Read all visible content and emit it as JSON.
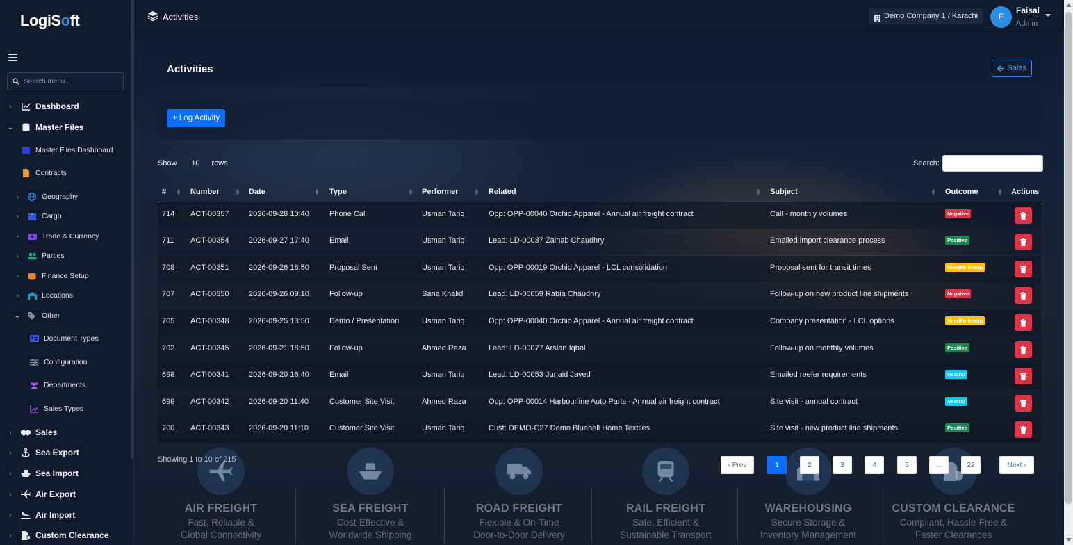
{
  "app": {
    "logo_part1": "LogiS",
    "logo_o": "o",
    "logo_part2": "ft"
  },
  "sidebar": {
    "search_placeholder": "Search menu...",
    "items": [
      {
        "label": "Dashboard"
      },
      {
        "label": "Master Files"
      },
      {
        "label": "Master Files Dashboard"
      },
      {
        "label": "Contracts"
      },
      {
        "label": "Geography"
      },
      {
        "label": "Cargo"
      },
      {
        "label": "Trade & Currency"
      },
      {
        "label": "Parties"
      },
      {
        "label": "Finance Setup"
      },
      {
        "label": "Locations"
      },
      {
        "label": "Other"
      },
      {
        "label": "Document Types"
      },
      {
        "label": "Configuration"
      },
      {
        "label": "Departments"
      },
      {
        "label": "Sales Types"
      },
      {
        "label": "Sales"
      },
      {
        "label": "Sea Export"
      },
      {
        "label": "Sea Import"
      },
      {
        "label": "Air Export"
      },
      {
        "label": "Air Import"
      },
      {
        "label": "Custom Clearance"
      }
    ]
  },
  "topbar": {
    "title": "Activities",
    "company": "Demo Company 1 / Karachi",
    "user_initial": "F",
    "user_name": "Faisal",
    "user_role": "Admin"
  },
  "page": {
    "title": "Activities",
    "back_label": "Sales",
    "log_button": "+ Log Activity",
    "show_label": "Show",
    "rows_value": "10",
    "rows_label": "rows",
    "search_label": "Search:"
  },
  "table": {
    "columns": [
      "#",
      "Number",
      "Date",
      "Type",
      "Performer",
      "Related",
      "Subject",
      "Outcome",
      "Actions"
    ],
    "rows": [
      {
        "id": "714",
        "number": "ACT-00357",
        "date": "2026-09-28 10:40",
        "type": "Phone Call",
        "performer": "Usman Tariq",
        "related": "Opp: OPP-00040 Orchid Apparel - Annual air freight contract",
        "subject": "Call - monthly volumes",
        "outcome": "Negative"
      },
      {
        "id": "711",
        "number": "ACT-00354",
        "date": "2026-09-27 17:40",
        "type": "Email",
        "performer": "Usman Tariq",
        "related": "Lead: LD-00037 Zainab Chaudhry",
        "subject": "Emailed import clearance process",
        "outcome": "Positive"
      },
      {
        "id": "708",
        "number": "ACT-00351",
        "date": "2026-09-26 18:50",
        "type": "Proposal Sent",
        "performer": "Usman Tariq",
        "related": "Opp: OPP-00019 Orchid Apparel - LCL consolidation",
        "subject": "Proposal sent for transit times",
        "outcome": "NeedFollowup"
      },
      {
        "id": "707",
        "number": "ACT-00350",
        "date": "2026-09-26 09:10",
        "type": "Follow-up",
        "performer": "Sana Khalid",
        "related": "Lead: LD-00059 Rabia Chaudhry",
        "subject": "Follow-up on new product line shipments",
        "outcome": "Negative"
      },
      {
        "id": "705",
        "number": "ACT-00348",
        "date": "2026-09-25 13:50",
        "type": "Demo / Presentation",
        "performer": "Usman Tariq",
        "related": "Opp: OPP-00040 Orchid Apparel - Annual air freight contract",
        "subject": "Company presentation - LCL options",
        "outcome": "NeedFollowup"
      },
      {
        "id": "702",
        "number": "ACT-00345",
        "date": "2026-09-21 18:50",
        "type": "Follow-up",
        "performer": "Ahmed Raza",
        "related": "Lead: LD-00077 Arslan Iqbal",
        "subject": "Follow-up on monthly volumes",
        "outcome": "Positive"
      },
      {
        "id": "698",
        "number": "ACT-00341",
        "date": "2026-09-20 16:40",
        "type": "Email",
        "performer": "Usman Tariq",
        "related": "Lead: LD-00053 Junaid Javed",
        "subject": "Emailed reefer requirements",
        "outcome": "Neutral"
      },
      {
        "id": "699",
        "number": "ACT-00342",
        "date": "2026-09-20 11:40",
        "type": "Customer Site Visit",
        "performer": "Ahmed Raza",
        "related": "Opp: OPP-00014 Harbourline Auto Parts - Annual air freight contract",
        "subject": "Site visit - annual contract",
        "outcome": "Neutral"
      },
      {
        "id": "700",
        "number": "ACT-00343",
        "date": "2026-09-20 11:10",
        "type": "Customer Site Visit",
        "performer": "Usman Tariq",
        "related": "Cust: DEMO-C27 Demo Bluebell Home Textiles",
        "subject": "Site visit - new product line shipments",
        "outcome": "Positive"
      }
    ]
  },
  "outcome_colors": {
    "Negative": "#dc3545",
    "Positive": "#198754",
    "NeedFollowup": "#ffc107",
    "Neutral": "#0dcaf0"
  },
  "pagination": {
    "showing": "Showing 1 to 10 of 215",
    "prev": "‹ Prev",
    "pages": [
      "1",
      "2",
      "3",
      "4",
      "5",
      "...",
      "22"
    ],
    "next": "Next ›",
    "current": "1"
  },
  "services": [
    {
      "title": "AIR FREIGHT",
      "line1": "Fast, Reliable &",
      "line2": "Global Connectivity"
    },
    {
      "title": "SEA FREIGHT",
      "line1": "Cost-Effective &",
      "line2": "Worldwide Shipping"
    },
    {
      "title": "ROAD FREIGHT",
      "line1": "Flexible & On-Time",
      "line2": "Door-to-Door Delivery"
    },
    {
      "title": "RAIL FREIGHT",
      "line1": "Safe, Efficient &",
      "line2": "Sustainable Transport"
    },
    {
      "title": "WAREHOUSING",
      "line1": "Secure Storage &",
      "line2": "Inventory Management"
    },
    {
      "title": "CUSTOM CLEARANCE",
      "line1": "Compliant, Hassle-Free &",
      "line2": "Faster Clearances"
    }
  ]
}
